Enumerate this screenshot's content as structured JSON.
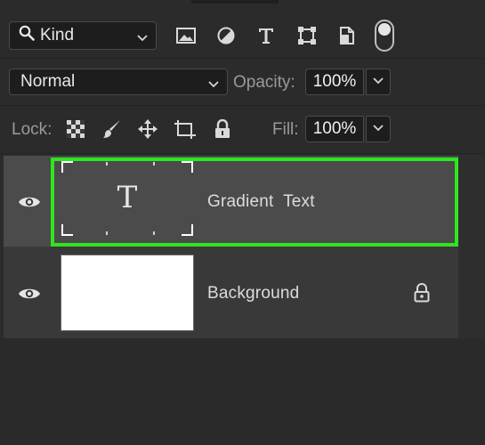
{
  "filter": {
    "kind_label": "Kind",
    "icons": [
      "image-filter-icon",
      "adjustment-filter-icon",
      "type-filter-icon",
      "shape-filter-icon",
      "smart-object-filter-icon"
    ],
    "filter_toggle": "on"
  },
  "blend": {
    "mode": "Normal",
    "opacity_label": "Opacity:",
    "opacity_value": "100%"
  },
  "lock": {
    "label": "Lock:",
    "icons": [
      "lock-transparent-pixels-icon",
      "lock-image-pixels-icon",
      "lock-position-icon",
      "lock-artboard-icon",
      "lock-all-icon"
    ],
    "fill_label": "Fill:",
    "fill_value": "100%"
  },
  "layers": [
    {
      "name": "Gradient  Text",
      "type": "text",
      "thumb_glyph": "T",
      "selected": true,
      "visible": true
    },
    {
      "name": "Background",
      "type": "pixel",
      "selected": false,
      "visible": true,
      "locked": true
    }
  ],
  "colors": {
    "panel_bg": "#2b2b2b",
    "selected_row": "#4b4b4b",
    "layer_row": "#393939",
    "highlight": "#2ee61f"
  }
}
